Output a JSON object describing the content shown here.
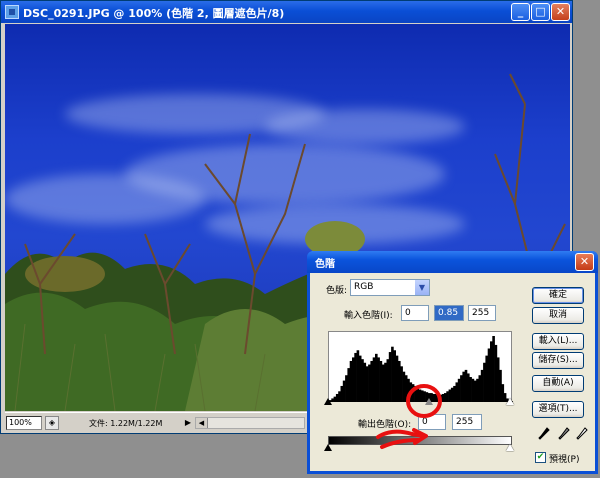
{
  "document": {
    "title": "DSC_0291.JPG @ 100% (色階 2, 圖層遮色片/8)",
    "zoom": "100%",
    "file_size": "文件: 1.22M/1.22M",
    "controls": {
      "minimize": "_",
      "restore": "□",
      "close": "✕"
    }
  },
  "levels": {
    "title": "色階",
    "channel_label": "色版:",
    "channel_value": "RGB",
    "input_label": "輸入色階(I):",
    "input_values": [
      "0",
      "0.85",
      "255"
    ],
    "output_label": "輸出色階(O):",
    "output_values": [
      "0",
      "255"
    ],
    "buttons": {
      "ok": "確定",
      "cancel": "取消",
      "load": "載入(L)...",
      "save": "儲存(S)...",
      "auto": "自動(A)",
      "options": "選項(T)..."
    },
    "preview_label": "預視(P)",
    "preview_checked": true,
    "histogram": [
      2,
      4,
      6,
      9,
      12,
      18,
      24,
      30,
      38,
      46,
      50,
      55,
      58,
      52,
      48,
      44,
      40,
      42,
      46,
      50,
      54,
      50,
      46,
      42,
      44,
      48,
      56,
      62,
      58,
      52,
      46,
      40,
      34,
      30,
      26,
      22,
      20,
      18,
      16,
      14,
      13,
      12,
      11,
      10,
      10,
      9,
      9,
      8,
      8,
      9,
      10,
      12,
      14,
      16,
      18,
      22,
      26,
      30,
      34,
      36,
      32,
      28,
      26,
      24,
      26,
      30,
      36,
      44,
      52,
      60,
      68,
      74,
      64,
      50,
      36,
      20,
      10,
      4,
      2,
      1
    ]
  },
  "colors": {
    "titlebar": "#0a4fd6",
    "annotation": "#e81010"
  }
}
